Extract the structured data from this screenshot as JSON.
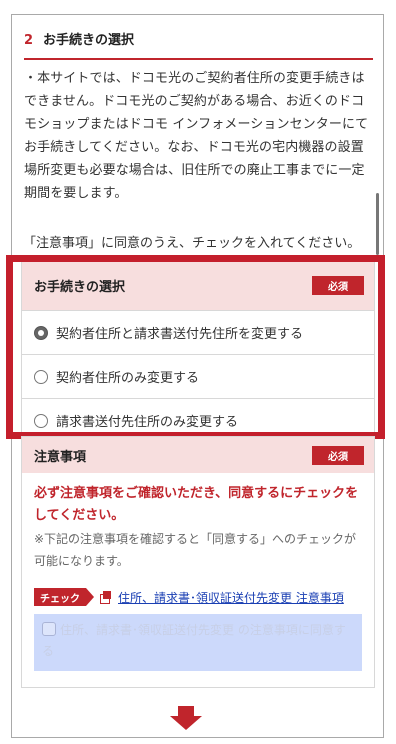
{
  "section": {
    "number": "2",
    "title": "お手続きの選択"
  },
  "intro_text": "・本サイトでは、ドコモ光のご契約者住所の変更手続きはできません。ドコモ光のご契約がある場合、お近くのドコモショップまたはドコモ インフォメーションセンターにてお手続きしてください。なお、ドコモ光の宅内機器の設置場所変更も必要な場合は、旧住所での廃止工事までに一定期間を要します。",
  "consent_note": "「注意事項」に同意のうえ、チェックを入れてください。",
  "procedure": {
    "title": "お手続きの選択",
    "required_label": "必須",
    "options": [
      {
        "label": "契約者住所と請求書送付先住所を変更する",
        "checked": true
      },
      {
        "label": "契約者住所のみ変更する",
        "checked": false
      },
      {
        "label": "請求書送付先住所のみ変更する",
        "checked": false
      }
    ]
  },
  "notice": {
    "title": "注意事項",
    "required_label": "必須",
    "warning": "必ず注意事項をご確認いただき、同意するにチェックをしてください。",
    "sub": "※下記の注意事項を確認すると「同意する」へのチェックが可能になります。",
    "check_tag": "チェック",
    "link_text": "住所、請求書･領収証送付先変更 注意事項",
    "agree_text": "住所、請求書･領収証送付先変更 の注意事項に同意する",
    "agree_checked": false
  },
  "colors": {
    "accent": "#c0252c",
    "highlight_border": "#c41f2c",
    "header_bg": "#f7dede",
    "link": "#1a3fb3",
    "agree_bg": "#ccd9fb"
  },
  "icons": {
    "external_link": "external-link-icon",
    "arrow": "down-arrow-icon"
  }
}
